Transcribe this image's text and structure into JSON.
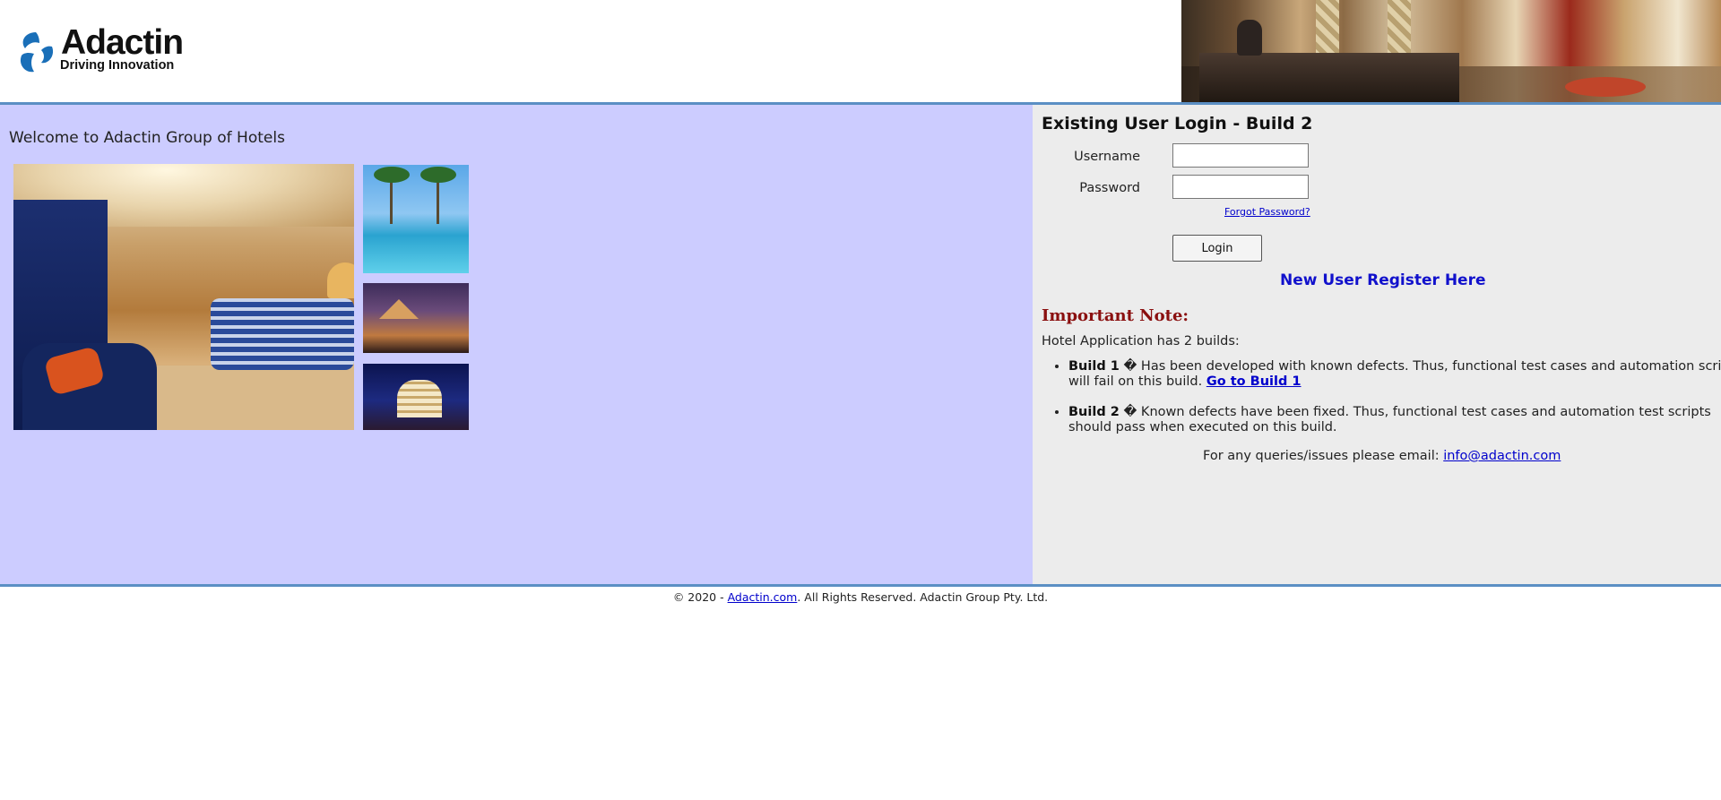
{
  "header": {
    "logo_name": "Adactin",
    "logo_tagline": "Driving Innovation",
    "banner_image": "hotel-lobby-image"
  },
  "main": {
    "welcome": "Welcome to Adactin Group of Hotels",
    "images": [
      "hotel-room-image",
      "pool-image",
      "resort-tent-image",
      "hotel-building-image"
    ]
  },
  "login": {
    "title": "Existing User Login - Build 2",
    "username_label": "Username",
    "password_label": "Password",
    "username_value": "",
    "password_value": "",
    "forgot_link": "Forgot Password?",
    "login_button": "Login",
    "register_link": "New User Register Here"
  },
  "note": {
    "title": "Important Note:",
    "intro": "Hotel Application has 2 builds:",
    "build1_name": "Build 1",
    "build1_text": " � Has been developed with known defects. Thus, functional test cases and automation scripts will fail on this build. ",
    "build1_link": "Go to Build 1",
    "build2_name": "Build 2",
    "build2_text": " � Known defects have been fixed. Thus, functional test cases and automation test scripts should pass when executed on this build.",
    "queries_text": "For any queries/issues please email: ",
    "queries_email": "info@adactin.com"
  },
  "footer": {
    "prefix": "© 2020 - ",
    "link": "Adactin.com",
    "suffix": ". All Rights Reserved. Adactin Group Pty. Ltd."
  },
  "colors": {
    "left_panel_bg": "#ccccff",
    "right_panel_bg": "#ececec",
    "divider": "#5b8fc4",
    "link": "#0000cc",
    "note_title": "#8a0f0f"
  }
}
